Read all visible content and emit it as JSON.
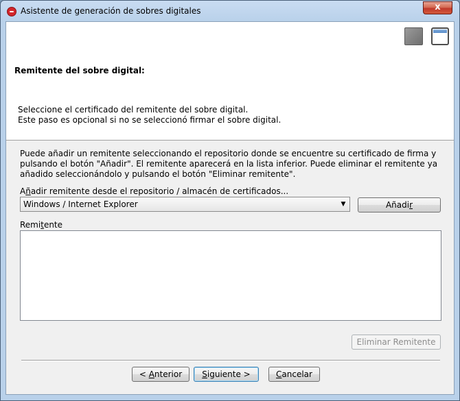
{
  "window": {
    "title": "Asistente de generación de sobres digitales",
    "close_label": "x"
  },
  "header": {
    "title": "Remitente del sobre digital:",
    "desc_line1": "Seleccione el certificado del remitente del sobre digital.",
    "desc_line2": "Este paso es opcional si no se seleccionó firmar el sobre digital."
  },
  "body": {
    "info_text": "Puede añadir un remitente seleccionando el repositorio donde se encuentre su certificado de firma y pulsando el botón \"Añadir\". El remitente aparecerá en la lista inferior. Puede eliminar el remitente ya añadido seleccionándolo y pulsando el botón \"Eliminar remitente\".",
    "repo_label_pre": "A",
    "repo_label_mnemonic": "ñ",
    "repo_label_post": "adir remitente desde el repositorio / almacén de certificados...",
    "repo_selected": "Windows / Internet Explorer",
    "add_label_pre": "Añadi",
    "add_label_mnemonic": "r",
    "remitente_label_pre": "Remi",
    "remitente_label_mnemonic": "t",
    "remitente_label_post": "ente",
    "remove_label": "Eliminar Remitente"
  },
  "footer": {
    "prev_label_pre": "< ",
    "prev_label_mnemonic": "A",
    "prev_label_post": "nterior",
    "next_label_pre": "",
    "next_label_mnemonic": "S",
    "next_label_post": "iguiente >",
    "cancel_label_pre": "",
    "cancel_label_mnemonic": "C",
    "cancel_label_post": "ancelar"
  },
  "icons": {
    "app": "app-logo-icon",
    "header_grey": "step-indicator-icon",
    "header_window": "window-icon"
  },
  "colors": {
    "frame": "#b9d1ea",
    "close": "#c0392b"
  }
}
